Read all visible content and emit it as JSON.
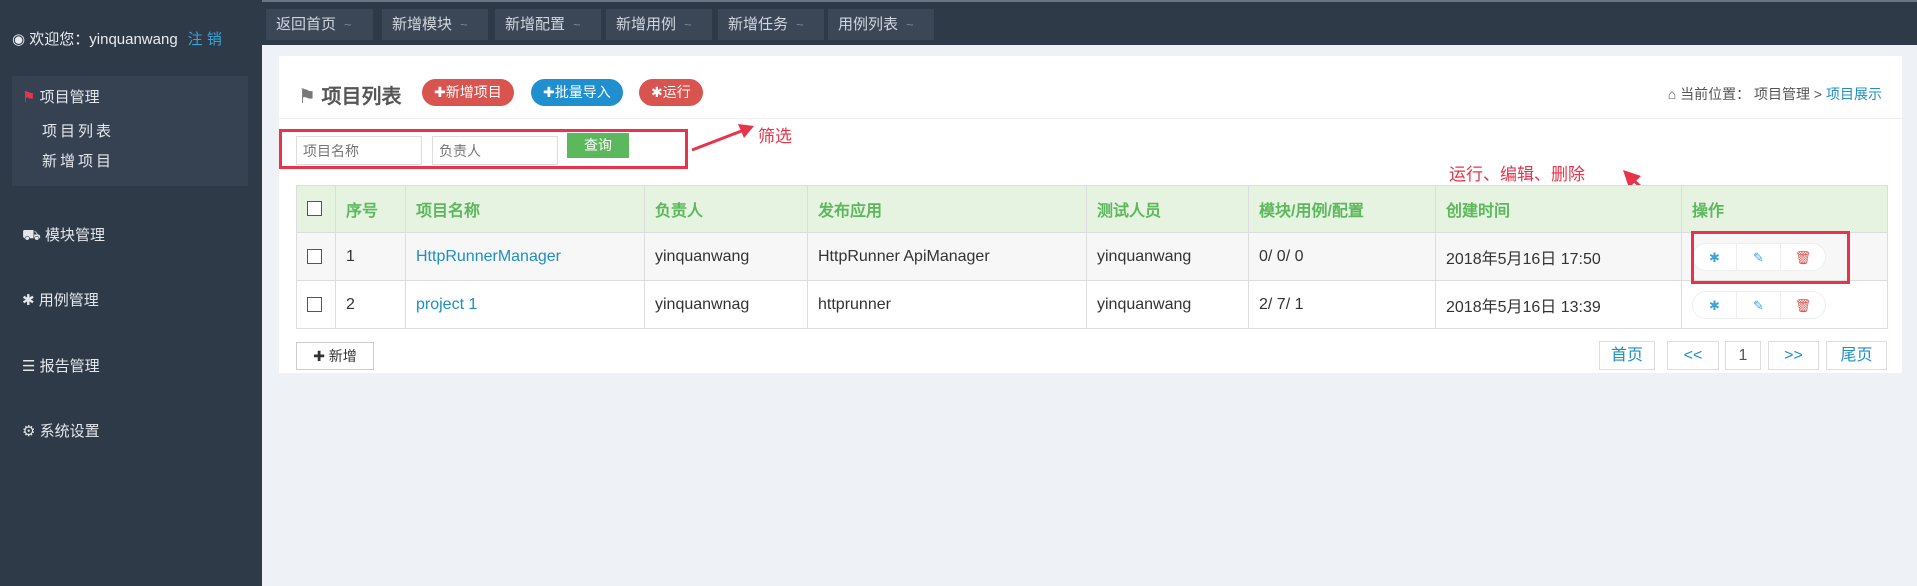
{
  "sidebar": {
    "welcome": "欢迎您：yinquanwang",
    "logout": "注 销",
    "group": "项目管理",
    "sub_items": [
      "项目列表",
      "新增项目"
    ],
    "menus": [
      "模块管理",
      "用例管理",
      "报告管理",
      "系统设置"
    ]
  },
  "tabs": [
    "返回首页",
    "新增模块",
    "新增配置",
    "新增用例",
    "新增任务",
    "用例列表"
  ],
  "tab_suffix": "~",
  "panel": {
    "title": "项目列表",
    "buttons": {
      "add": "✚新增项目",
      "import": "✚批量导入",
      "run": "运行"
    },
    "breadcrumb": {
      "prefix": "当前位置：",
      "parent": "项目管理",
      "sep": ">",
      "current": "项目展示"
    }
  },
  "filter": {
    "name_placeholder": "项目名称",
    "owner_placeholder": "负责人",
    "query": "查询"
  },
  "table": {
    "headers": [
      "序号",
      "项目名称",
      "负责人",
      "发布应用",
      "测试人员",
      "模块/用例/配置",
      "创建时间",
      "操作"
    ],
    "rows": [
      [
        "1",
        "HttpRunnerManager",
        "yinquanwang",
        "HttpRunner ApiManager",
        "yinquanwang",
        "0/ 0/ 0",
        "2018年5月16日 17:50"
      ],
      [
        "2",
        "project 1",
        "yinquanwnag",
        "httprunner",
        "yinquanwang",
        "2/ 7/ 1",
        "2018年5月16日 13:39"
      ]
    ]
  },
  "add_button": "✚ 新增",
  "pagination": [
    "首页",
    "<<",
    "1",
    ">>",
    "尾页"
  ],
  "annotations": {
    "filter": "筛选",
    "actions": "运行、编辑、删除"
  },
  "colors": {
    "sidebar": "#2f3a48",
    "green": "#5cb85c",
    "blue": "#1d8fc4",
    "red": "#d9534f",
    "annotation": "#e8344a"
  }
}
